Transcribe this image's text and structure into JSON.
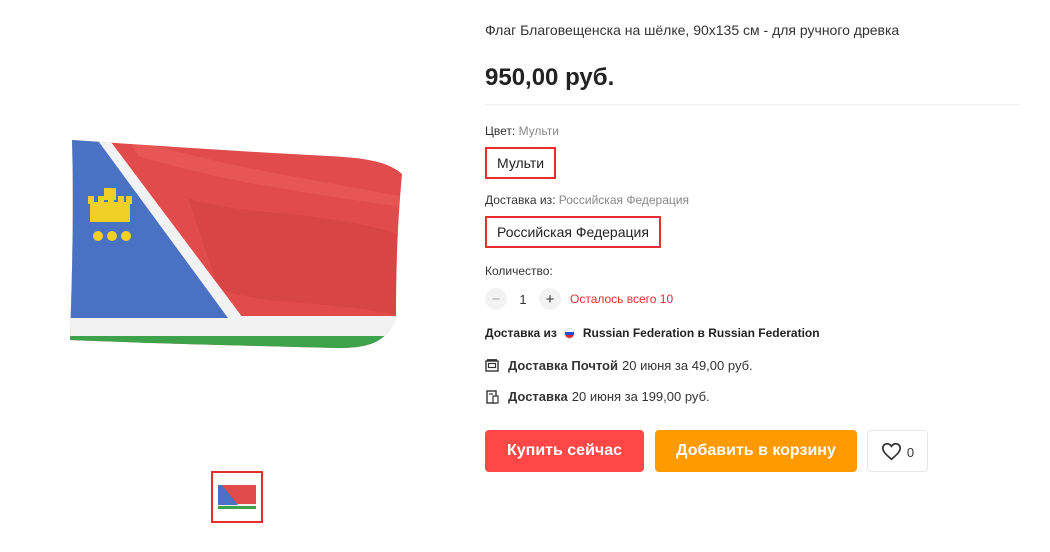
{
  "product": {
    "title": "Флаг Благовещенска на шёлке, 90х135 см - для ручного древка",
    "price": "950,00 руб."
  },
  "color": {
    "label": "Цвет: ",
    "value": "Мульти",
    "option": "Мульти"
  },
  "ship_origin": {
    "label": "Доставка из: ",
    "value": "Российская Федерация",
    "option": "Российская Федерация"
  },
  "quantity": {
    "label": "Количество:",
    "minus": "−",
    "value": "1",
    "plus": "+",
    "stock_note": "Осталось всего 10"
  },
  "shipping": {
    "from_prefix": "Доставка из",
    "from_text": "Russian Federation в Russian Federation",
    "options": [
      {
        "name": "Доставка Почтой",
        "info": "20 июня за 49,00 руб.",
        "icon": "mail-box-icon"
      },
      {
        "name": "Доставка",
        "info": "20 июня за 199,00 руб.",
        "icon": "package-icon"
      }
    ]
  },
  "actions": {
    "buy_now": "Купить сейчас",
    "add_to_cart": "Добавить в корзину",
    "wishlist_count": "0"
  },
  "colors": {
    "accent_red": "#ff4747",
    "accent_orange": "#ff9a00",
    "selected_border": "#e62e2e"
  }
}
